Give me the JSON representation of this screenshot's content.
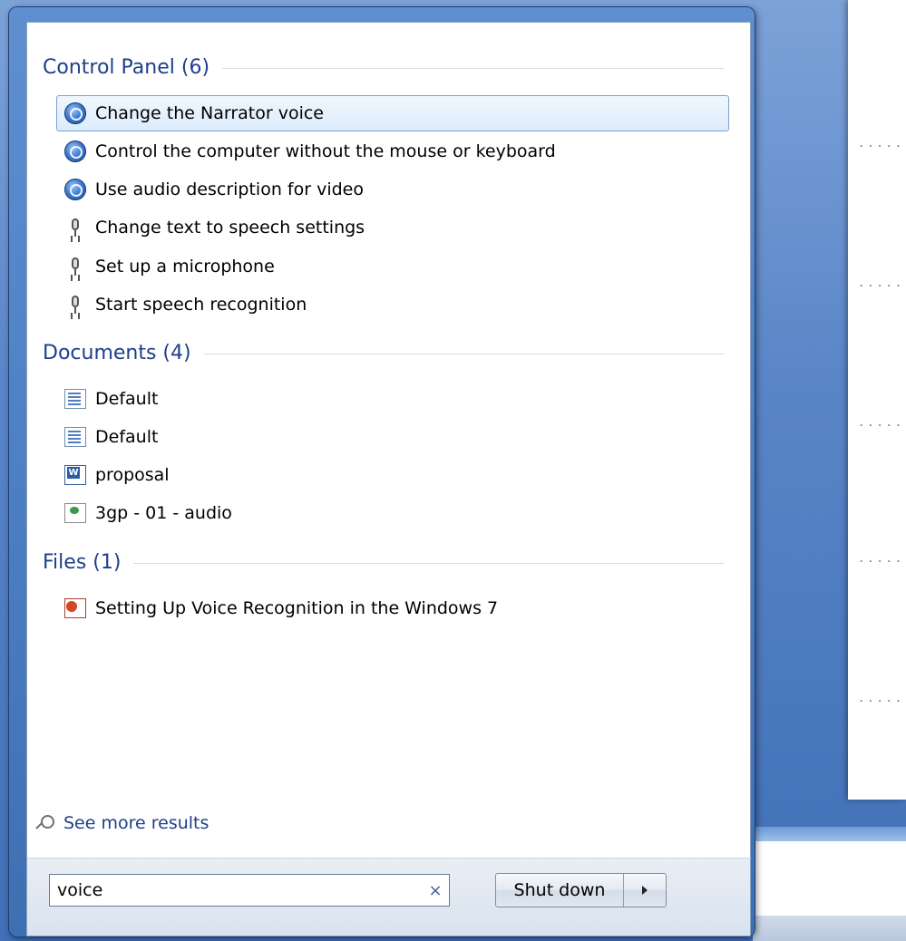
{
  "start_menu": {
    "groups": [
      {
        "title": "Control Panel (6)",
        "items": [
          {
            "label": "Change the Narrator voice",
            "icon": "accessibility-icon",
            "selected": true
          },
          {
            "label": "Control the computer without the mouse or keyboard",
            "icon": "accessibility-icon"
          },
          {
            "label": "Use audio description for video",
            "icon": "accessibility-icon"
          },
          {
            "label": "Change text to speech settings",
            "icon": "microphone-icon"
          },
          {
            "label": "Set up a microphone",
            "icon": "microphone-icon"
          },
          {
            "label": "Start speech recognition",
            "icon": "microphone-icon"
          }
        ]
      },
      {
        "title": "Documents (4)",
        "items": [
          {
            "label": "Default",
            "icon": "text-document-icon"
          },
          {
            "label": "Default",
            "icon": "text-document-icon"
          },
          {
            "label": "proposal",
            "icon": "word-document-icon"
          },
          {
            "label": "3gp - 01 - audio",
            "icon": "media-file-icon"
          }
        ]
      },
      {
        "title": "Files (1)",
        "items": [
          {
            "label": "Setting Up Voice Recognition in the Windows 7",
            "icon": "powerpoint-file-icon"
          }
        ]
      }
    ],
    "see_more": "See more results",
    "search": {
      "value": "voice",
      "clear_glyph": "×"
    },
    "shutdown": {
      "label": "Shut down"
    }
  },
  "background": {
    "dots": "....."
  }
}
